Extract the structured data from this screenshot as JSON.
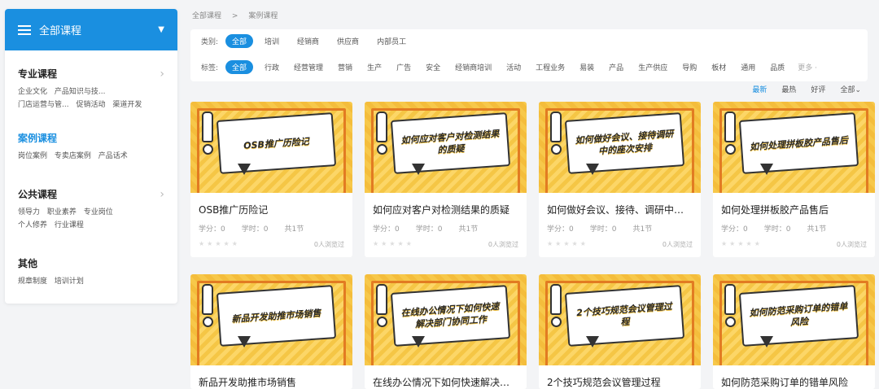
{
  "sidebar": {
    "header": "全部课程",
    "sections": [
      {
        "title": "专业课程",
        "links": [
          "企业文化",
          "产品知识与技...",
          "门店运营与管...",
          "促销活动",
          "渠道开发"
        ]
      },
      {
        "title": "案例课程",
        "links": [
          "岗位案例",
          "专卖店案例",
          "产品话术"
        ]
      },
      {
        "title": "公共课程",
        "links": [
          "领导力",
          "职业素养",
          "专业岗位",
          "个人修养",
          "行业课程"
        ]
      },
      {
        "title": "其他",
        "links": [
          "规章制度",
          "培训计划"
        ]
      }
    ]
  },
  "breadcrumb": {
    "root": "全部课程",
    "sep": ">",
    "current": "案例课程"
  },
  "filters": {
    "category_label": "类别:",
    "categories": [
      "全部",
      "培训",
      "经销商",
      "供应商",
      "内部员工"
    ],
    "tag_label": "标签:",
    "tags": [
      "全部",
      "行政",
      "经营管理",
      "营销",
      "生产",
      "广告",
      "安全",
      "经销商培训",
      "活动",
      "工程业务",
      "易装",
      "产品",
      "生产供应",
      "导购",
      "板材",
      "通用",
      "品质"
    ],
    "more": "更多"
  },
  "sort": {
    "options": [
      "最新",
      "最热",
      "好评"
    ],
    "all": "全部"
  },
  "courses": [
    {
      "thumb_text": "OSB推广历险记",
      "title": "OSB推广历险记",
      "credit": "学分：0",
      "hours": "学时：0",
      "lessons": "共1节",
      "views": "0人浏览过"
    },
    {
      "thumb_text": "如何应对客户对检测结果的质疑",
      "title": "如何应对客户对检测结果的质疑",
      "credit": "学分：0",
      "hours": "学时：0",
      "lessons": "共1节",
      "views": "0人浏览过"
    },
    {
      "thumb_text": "如何做好会议、接待调研中的座次安排",
      "title": "如何做好会议、接待、调研中的...",
      "credit": "学分：0",
      "hours": "学时：0",
      "lessons": "共1节",
      "views": "0人浏览过"
    },
    {
      "thumb_text": "如何处理拼板胶产品售后",
      "title": "如何处理拼板胶产品售后",
      "credit": "学分：0",
      "hours": "学时：0",
      "lessons": "共1节",
      "views": "0人浏览过"
    },
    {
      "thumb_text": "新品开发助推市场销售",
      "title": "新品开发助推市场销售",
      "credit": "",
      "hours": "",
      "lessons": "",
      "views": ""
    },
    {
      "thumb_text": "在线办公情况下如何快速解决部门协同工作",
      "title": "在线办公情况下如何快速解决部...",
      "credit": "",
      "hours": "",
      "lessons": "",
      "views": ""
    },
    {
      "thumb_text": "2个技巧规范会议管理过程",
      "title": "2个技巧规范会议管理过程",
      "credit": "",
      "hours": "",
      "lessons": "",
      "views": ""
    },
    {
      "thumb_text": "如何防范采购订单的错单风险",
      "title": "如何防范采购订单的错单风险",
      "credit": "",
      "hours": "",
      "lessons": "",
      "views": ""
    }
  ],
  "colors": {
    "accent": "#1a8fe0",
    "thumb_bg": "#f7c84a",
    "thumb_frame": "#e27b22"
  }
}
